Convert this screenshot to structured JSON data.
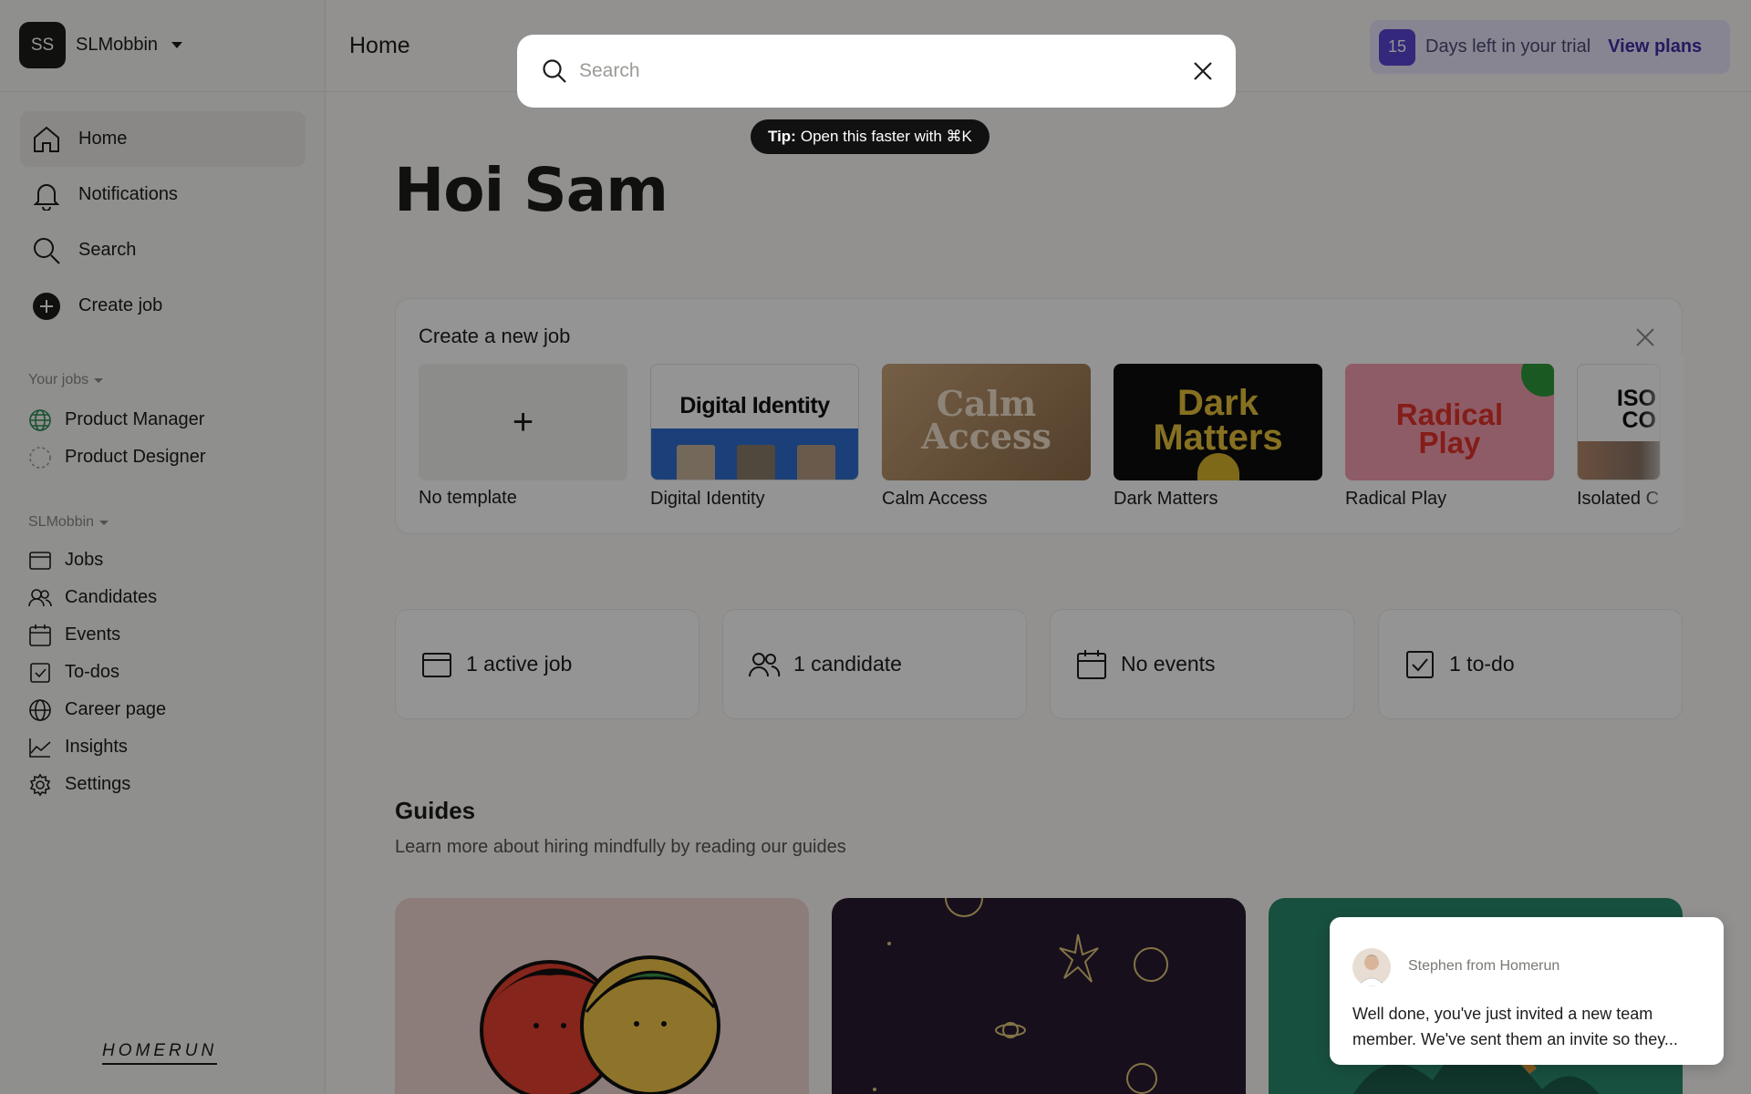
{
  "workspace": {
    "initials": "SS",
    "name": "SLMobbin"
  },
  "header": {
    "title": "Home"
  },
  "trial": {
    "days": "15",
    "text": "Days left in your trial",
    "cta": "View plans"
  },
  "nav": {
    "home": "Home",
    "notifications": "Notifications",
    "search": "Search",
    "create_job": "Create job"
  },
  "your_jobs": {
    "label": "Your jobs",
    "items": [
      "Product Manager",
      "Product Designer"
    ]
  },
  "company": {
    "label": "SLMobbin",
    "items": [
      "Jobs",
      "Candidates",
      "Events",
      "To-dos",
      "Career page",
      "Insights",
      "Settings"
    ]
  },
  "logo": "HOMERUN",
  "greeting": "Hoi Sam",
  "create_job_card": {
    "title": "Create a new job",
    "templates": [
      {
        "label": "No template"
      },
      {
        "label": "Digital Identity",
        "thumb_title": "Digital Identity"
      },
      {
        "label": "Calm Access",
        "thumb_title_1": "Calm",
        "thumb_title_2": "Access"
      },
      {
        "label": "Dark Matters",
        "thumb_title_1": "Dark",
        "thumb_title_2": "Matters"
      },
      {
        "label": "Radical Play",
        "thumb_title_1": "Radical",
        "thumb_title_2": "Play"
      },
      {
        "label": "Isolated C",
        "thumb_title_1": "ISO",
        "thumb_title_2": "CO"
      }
    ]
  },
  "stats": {
    "jobs": "1 active job",
    "candidates": "1 candidate",
    "events": "No events",
    "todos": "1 to-do"
  },
  "guides": {
    "title": "Guides",
    "subtitle": "Learn more about hiring mindfully by reading our guides"
  },
  "search_modal": {
    "placeholder": "Search",
    "tip_label": "Tip:",
    "tip_text": "Open this faster with ⌘K"
  },
  "chat": {
    "from": "Stephen from Homerun",
    "message": "Well done, you've just invited a new team member. We've sent them an invite so they..."
  },
  "colors": {
    "accent": "#5a46d6",
    "dark": "#1d1d1b",
    "overlay": "rgba(0,0,0,0.42)"
  }
}
